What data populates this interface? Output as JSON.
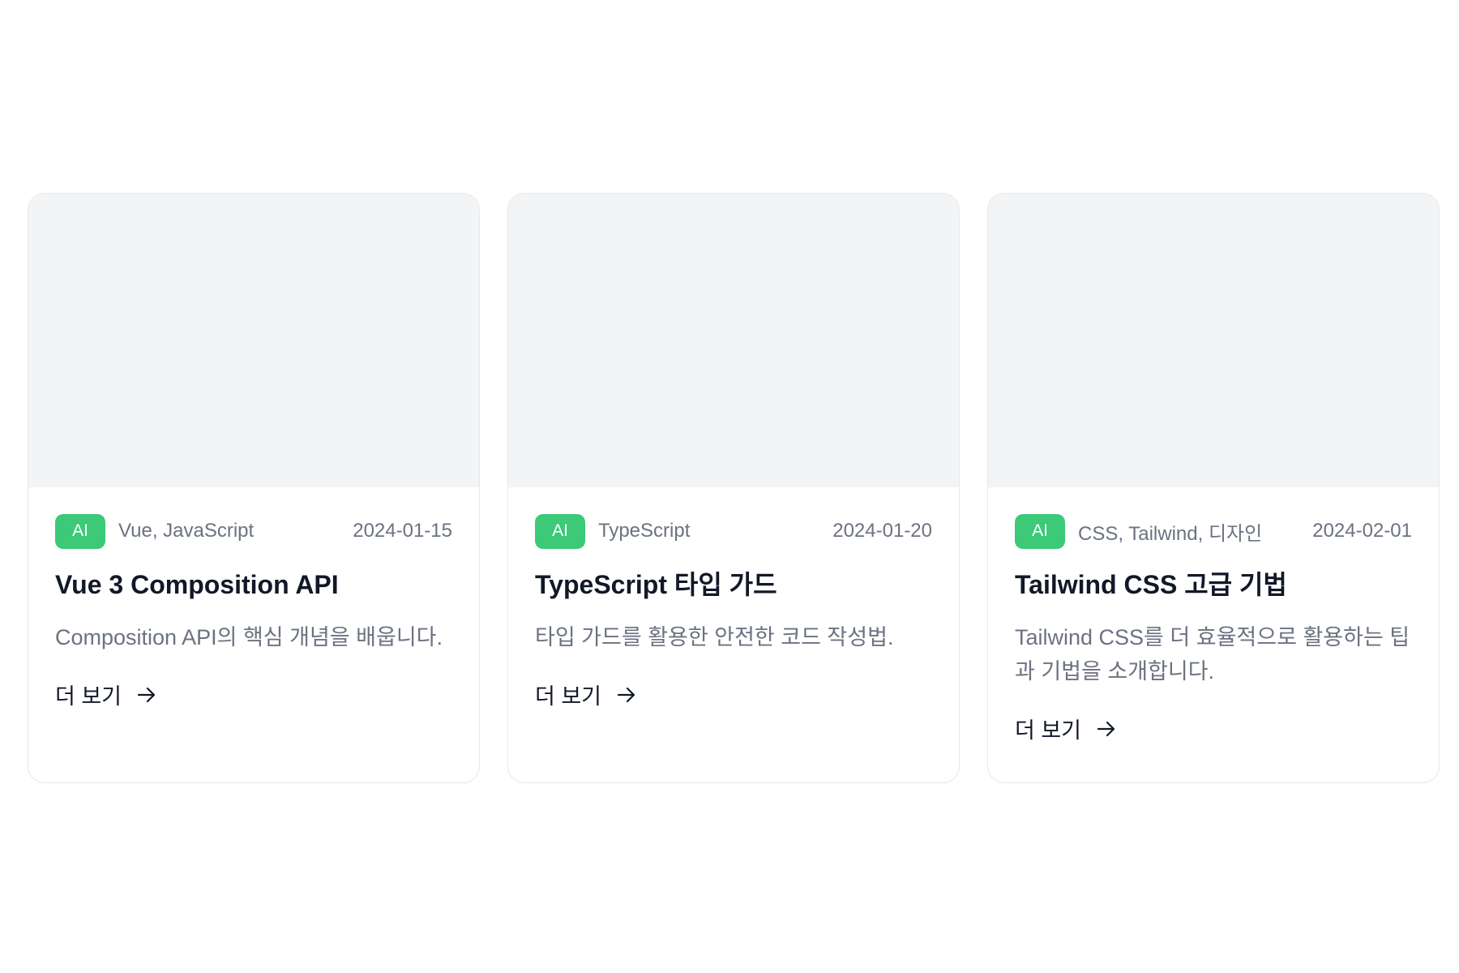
{
  "cards": [
    {
      "badge": "AI",
      "tags": "Vue, JavaScript",
      "date": "2024-01-15",
      "title": "Vue 3 Composition API",
      "description": "Composition API의 핵심 개념을 배웁니다.",
      "more_label": "더 보기"
    },
    {
      "badge": "AI",
      "tags": "TypeScript",
      "date": "2024-01-20",
      "title": "TypeScript 타입 가드",
      "description": "타입 가드를 활용한 안전한 코드 작성법.",
      "more_label": "더 보기"
    },
    {
      "badge": "AI",
      "tags": "CSS, Tailwind, 디자인",
      "date": "2024-02-01",
      "title": "Tailwind CSS 고급 기법",
      "description": "Tailwind CSS를 더 효율적으로 활용하는 팁과 기법을 소개합니다.",
      "more_label": "더 보기"
    }
  ],
  "icons": {
    "more": "arrow-right-icon"
  },
  "colors": {
    "badge_bg": "#3cc978",
    "thumbnail_bg": "#f3f4f6",
    "border": "#e5e7eb"
  }
}
